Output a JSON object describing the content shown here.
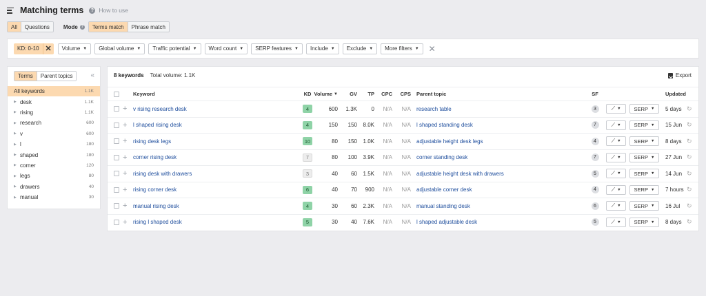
{
  "header": {
    "title": "Matching terms",
    "help_link": "How to use"
  },
  "mode_bar": {
    "scope_tabs": [
      "All",
      "Questions"
    ],
    "mode_label": "Mode",
    "mode_tabs": [
      "Terms match",
      "Phrase match"
    ]
  },
  "filters": {
    "kd_chip": "KD: 0-10",
    "buttons": [
      "Volume",
      "Global volume",
      "Traffic potential",
      "Word count",
      "SERP features",
      "Include",
      "Exclude",
      "More filters"
    ]
  },
  "sidebar": {
    "tabs": [
      "Terms",
      "Parent topics"
    ],
    "items": [
      {
        "label": "All keywords",
        "count": "1.1K"
      },
      {
        "label": "desk",
        "count": "1.1K"
      },
      {
        "label": "rising",
        "count": "1.1K"
      },
      {
        "label": "research",
        "count": "600"
      },
      {
        "label": "v",
        "count": "600"
      },
      {
        "label": "l",
        "count": "180"
      },
      {
        "label": "shaped",
        "count": "180"
      },
      {
        "label": "corner",
        "count": "120"
      },
      {
        "label": "legs",
        "count": "80"
      },
      {
        "label": "drawers",
        "count": "40"
      },
      {
        "label": "manual",
        "count": "30"
      }
    ]
  },
  "main": {
    "keyword_count": "8 keywords",
    "total_volume": "Total volume: 1.1K",
    "export_label": "Export",
    "columns": {
      "keyword": "Keyword",
      "kd": "KD",
      "volume": "Volume",
      "gv": "GV",
      "tp": "TP",
      "cpc": "CPC",
      "cps": "CPS",
      "parent_topic": "Parent topic",
      "sf": "SF",
      "updated": "Updated"
    },
    "rows": [
      {
        "keyword": "v rising research desk",
        "kd": "4",
        "volume": "600",
        "gv": "1.3K",
        "tp": "0",
        "cpc": "N/A",
        "cps": "N/A",
        "parent_topic": "research table",
        "sf": "3",
        "serp": "SERP",
        "updated": "5 days"
      },
      {
        "keyword": "l shaped rising desk",
        "kd": "4",
        "volume": "150",
        "gv": "150",
        "tp": "8.0K",
        "cpc": "N/A",
        "cps": "N/A",
        "parent_topic": "l shaped standing desk",
        "sf": "7",
        "serp": "SERP",
        "updated": "15 Jun"
      },
      {
        "keyword": "rising desk legs",
        "kd": "10",
        "volume": "80",
        "gv": "150",
        "tp": "1.0K",
        "cpc": "N/A",
        "cps": "N/A",
        "parent_topic": "adjustable height desk legs",
        "sf": "4",
        "serp": "SERP",
        "updated": "8 days"
      },
      {
        "keyword": "corner rising desk",
        "kd": "7",
        "volume": "80",
        "gv": "100",
        "tp": "3.9K",
        "cpc": "N/A",
        "cps": "N/A",
        "parent_topic": "corner standing desk",
        "sf": "7",
        "serp": "SERP",
        "updated": "27 Jun"
      },
      {
        "keyword": "rising desk with drawers",
        "kd": "3",
        "volume": "40",
        "gv": "60",
        "tp": "1.5K",
        "cpc": "N/A",
        "cps": "N/A",
        "parent_topic": "adjustable height desk with drawers",
        "sf": "5",
        "serp": "SERP",
        "updated": "14 Jun"
      },
      {
        "keyword": "rising corner desk",
        "kd": "6",
        "volume": "40",
        "gv": "70",
        "tp": "900",
        "cpc": "N/A",
        "cps": "N/A",
        "parent_topic": "adjustable corner desk",
        "sf": "4",
        "serp": "SERP",
        "updated": "7 hours"
      },
      {
        "keyword": "manual rising desk",
        "kd": "4",
        "volume": "30",
        "gv": "60",
        "tp": "2.3K",
        "cpc": "N/A",
        "cps": "N/A",
        "parent_topic": "manual standing desk",
        "sf": "6",
        "serp": "SERP",
        "updated": "16 Jul"
      },
      {
        "keyword": "rising l shaped desk",
        "kd": "5",
        "volume": "30",
        "gv": "40",
        "tp": "7.6K",
        "cpc": "N/A",
        "cps": "N/A",
        "parent_topic": "l shaped adjustable desk",
        "sf": "5",
        "serp": "SERP",
        "updated": "8 days"
      }
    ]
  },
  "colors": {
    "accent": "#fcd9b0",
    "link": "#1f4e9d",
    "kd_green": "#8fd3a7",
    "kd_gray": "#ededed"
  }
}
